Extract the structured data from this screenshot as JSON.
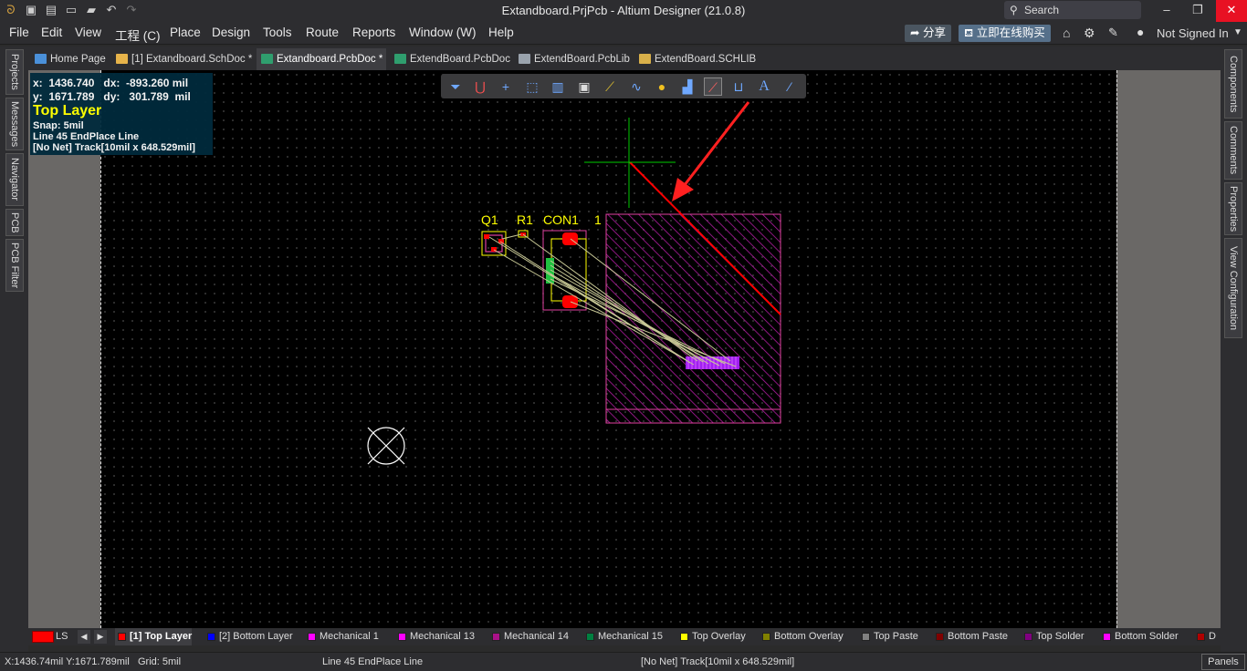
{
  "app": {
    "window_title": "Extandboard.PrjPcb - Altium Designer (21.0.8)",
    "search_placeholder": "Search"
  },
  "menu": [
    "File",
    "Edit",
    "View",
    "工程 (C)",
    "Place",
    "Design",
    "Tools",
    "Route",
    "Reports",
    "Window (W)",
    "Help"
  ],
  "header_buttons": {
    "share": "分享",
    "buy": "立即在线购买",
    "user": "Not Signed In"
  },
  "tabs": [
    {
      "label": "Home Page",
      "icon": "home-icon"
    },
    {
      "label": "[1] Extandboard.SchDoc *",
      "icon": "schematic-icon"
    },
    {
      "label": "Extandboard.PcbDoc *",
      "icon": "pcb-icon",
      "active": true
    },
    {
      "label": "ExtendBoard.PcbDoc",
      "icon": "pcb-icon"
    },
    {
      "label": "ExtendBoard.PcbLib",
      "icon": "pcblib-icon"
    },
    {
      "label": "ExtendBoard.SCHLIB",
      "icon": "schlib-icon"
    }
  ],
  "left_panels": [
    "Projects",
    "Messages",
    "Navigator",
    "PCB",
    "PCB Filter"
  ],
  "right_panels": [
    "Components",
    "Comments",
    "Properties",
    "View Configuration"
  ],
  "hud": {
    "x_line": "x:  1436.740   dx:  -893.260 mil",
    "y_line": "y:  1671.789   dy:   301.789  mil",
    "layer": "Top Layer",
    "snap": "Snap: 5mil",
    "action": "Line 45 EndPlace Line",
    "object": "[No Net] Track[10mil x 648.529mil]"
  },
  "designators": {
    "q1": "Q1",
    "r1": "R1",
    "con1": "CON1",
    "one": "1"
  },
  "layers": {
    "ls": "LS",
    "tabs": [
      {
        "label": "[1] Top Layer",
        "color": "#ff0000",
        "active": true
      },
      {
        "label": "[2] Bottom Layer",
        "color": "#0000ff"
      },
      {
        "label": "Mechanical 1",
        "color": "#ff00ff"
      },
      {
        "label": "Mechanical 13",
        "color": "#ff00ff"
      },
      {
        "label": "Mechanical 14",
        "color": "#aa1188"
      },
      {
        "label": "Mechanical 15",
        "color": "#008040"
      },
      {
        "label": "Top Overlay",
        "color": "#ffff00"
      },
      {
        "label": "Bottom Overlay",
        "color": "#808000"
      },
      {
        "label": "Top Paste",
        "color": "#808080"
      },
      {
        "label": "Bottom Paste",
        "color": "#800000"
      },
      {
        "label": "Top Solder",
        "color": "#800080"
      },
      {
        "label": "Bottom Solder",
        "color": "#ff00ff"
      },
      {
        "label": "D",
        "color": "#b00000"
      }
    ]
  },
  "status": {
    "coords": "X:1436.74mil Y:1671.789mil",
    "grid": "Grid: 5mil",
    "action": "Line 45 EndPlace Line",
    "object": "[No Net] Track[10mil x 648.529mil]",
    "panels": "Panels"
  }
}
